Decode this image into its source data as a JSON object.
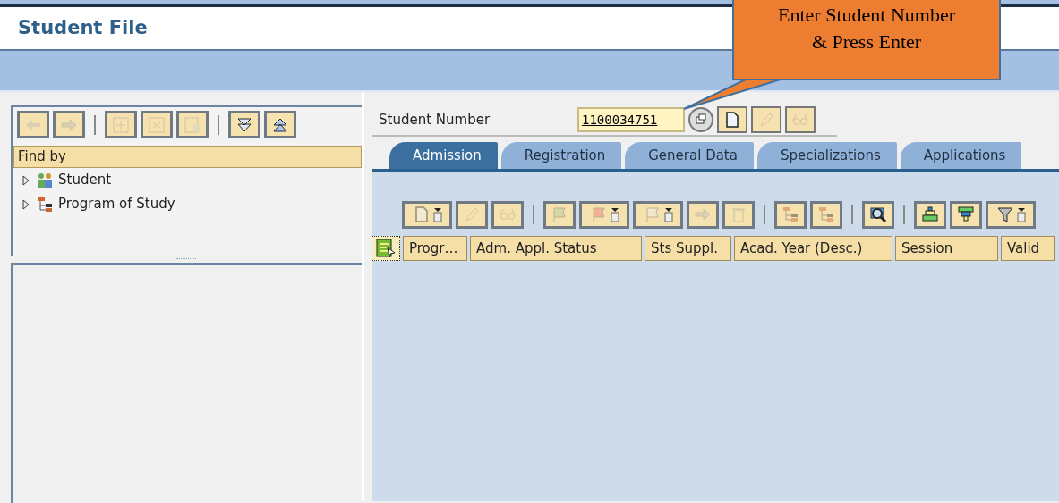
{
  "title": "Student File",
  "callout": {
    "text": "Enter Student Number & Press Enter"
  },
  "left_toolbar": [
    {
      "kind": "button",
      "disabled": true
    },
    {
      "kind": "button",
      "disabled": true
    },
    {
      "kind": "separator"
    },
    {
      "kind": "button",
      "disabled": true
    },
    {
      "kind": "button",
      "disabled": true
    },
    {
      "kind": "button",
      "disabled": true
    },
    {
      "kind": "separator"
    },
    {
      "kind": "button",
      "disabled": false
    },
    {
      "kind": "button",
      "disabled": false
    }
  ],
  "find_by": {
    "header": "Find by",
    "items": [
      {
        "label": "Student",
        "expanded": false
      },
      {
        "label": "Program of Study",
        "expanded": false
      }
    ]
  },
  "student_number": {
    "label": "Student Number",
    "value": "1100034751"
  },
  "field_buttons": [
    {
      "disabled": false
    },
    {
      "disabled": false
    },
    {
      "disabled": true
    },
    {
      "disabled": true
    }
  ],
  "tabs": [
    {
      "label": "Admission",
      "selected": true
    },
    {
      "label": "Registration",
      "selected": false
    },
    {
      "label": "General Data",
      "selected": false
    },
    {
      "label": "Specializations",
      "selected": false
    },
    {
      "label": "Applications",
      "selected": false
    }
  ],
  "table_toolbar": [
    {
      "kind": "button",
      "dropdown": true,
      "disabled": true
    },
    {
      "kind": "button",
      "dropdown": false,
      "disabled": true
    },
    {
      "kind": "button",
      "dropdown": false,
      "disabled": true
    },
    {
      "kind": "separator"
    },
    {
      "kind": "button",
      "dropdown": false,
      "disabled": true
    },
    {
      "kind": "button",
      "dropdown": true,
      "disabled": true
    },
    {
      "kind": "button",
      "dropdown": true,
      "disabled": true
    },
    {
      "kind": "button",
      "dropdown": false,
      "disabled": true
    },
    {
      "kind": "button",
      "dropdown": false,
      "disabled": true
    },
    {
      "kind": "separator"
    },
    {
      "kind": "button",
      "dropdown": false,
      "disabled": true
    },
    {
      "kind": "button",
      "dropdown": false,
      "disabled": true
    },
    {
      "kind": "separator"
    },
    {
      "kind": "button",
      "dropdown": false,
      "disabled": false
    },
    {
      "kind": "separator"
    },
    {
      "kind": "button",
      "dropdown": false,
      "disabled": false
    },
    {
      "kind": "button",
      "dropdown": false,
      "disabled": false
    },
    {
      "kind": "button",
      "dropdown": true,
      "disabled": false
    }
  ],
  "table": {
    "columns": [
      "Progr…",
      "Adm. Appl. Status",
      "Sts Suppl.",
      "Acad. Year (Desc.)",
      "Session",
      "Valid"
    ]
  }
}
